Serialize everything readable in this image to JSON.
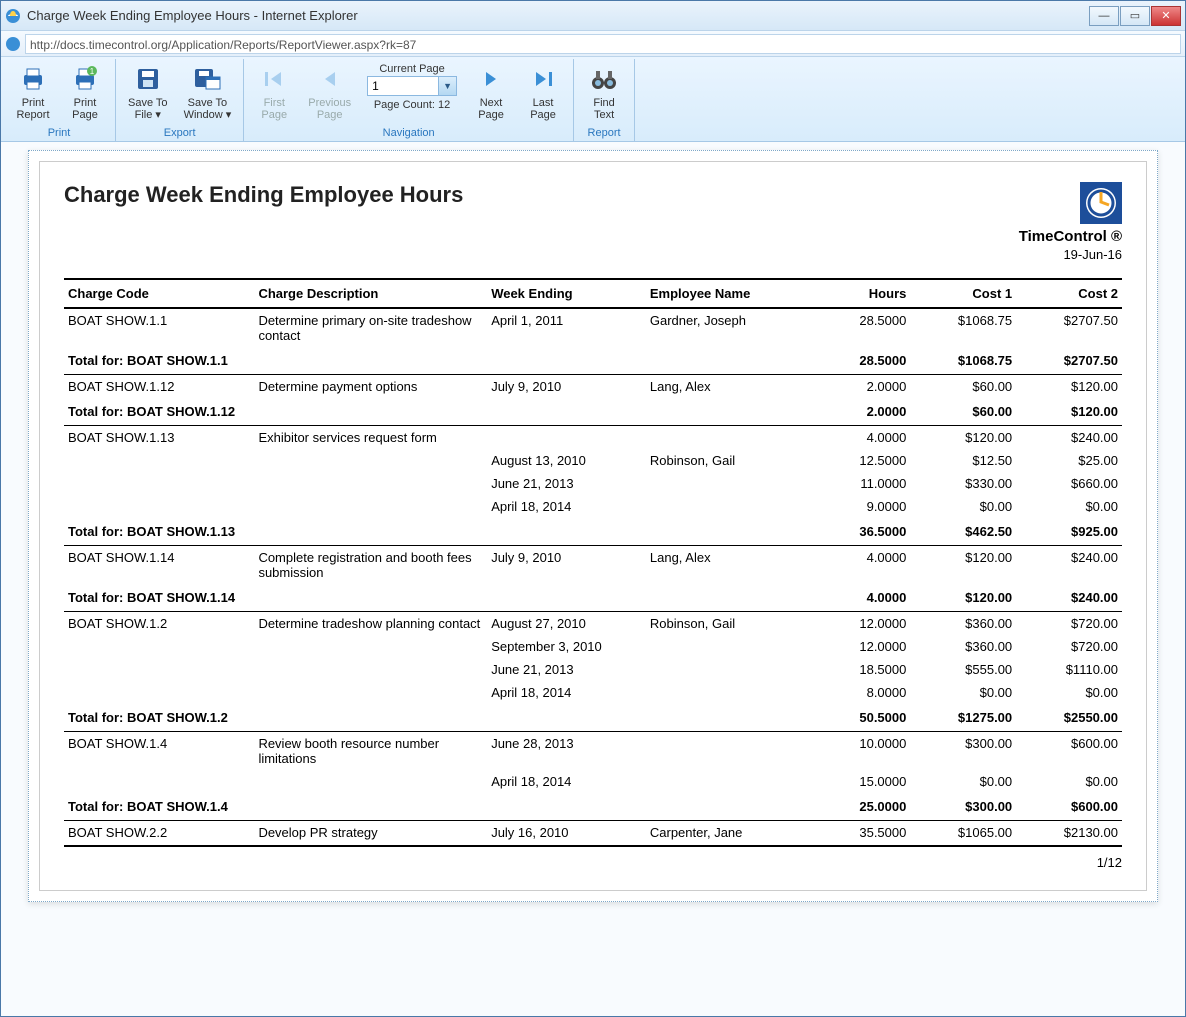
{
  "window": {
    "title": "Charge Week Ending Employee Hours - Internet Explorer",
    "url": "http://docs.timecontrol.org/Application/Reports/ReportViewer.aspx?rk=87"
  },
  "toolbar": {
    "groups": {
      "print": {
        "label": "Print",
        "print_report": "Print\nReport",
        "print_page": "Print\nPage"
      },
      "export": {
        "label": "Export",
        "save_to_file": "Save To\nFile ▾",
        "save_to_window": "Save To\nWindow ▾"
      },
      "navigation": {
        "label": "Navigation",
        "first_page": "First\nPage",
        "previous_page": "Previous\nPage",
        "next_page": "Next\nPage",
        "last_page": "Last\nPage",
        "current_page_label": "Current Page",
        "current_page_value": "1",
        "page_count_label": "Page Count: 12"
      },
      "report": {
        "label": "Report",
        "find_text": "Find\nText"
      }
    }
  },
  "report": {
    "title": "Charge Week Ending Employee Hours",
    "brand": "TimeControl ®",
    "date": "19-Jun-16",
    "page_footer": "1/12",
    "columns": {
      "charge_code": "Charge Code",
      "charge_description": "Charge Description",
      "week_ending": "Week Ending",
      "employee_name": "Employee Name",
      "hours": "Hours",
      "cost1": "Cost 1",
      "cost2": "Cost 2"
    },
    "total_prefix": "Total for: ",
    "groups": [
      {
        "code": "BOAT SHOW.1.1",
        "description": "Determine primary on-site tradeshow contact",
        "rows": [
          {
            "week": "April 1, 2011",
            "employee": "Gardner, Joseph",
            "hours": "28.5000",
            "cost1": "$1068.75",
            "cost2": "$2707.50"
          }
        ],
        "total": {
          "hours": "28.5000",
          "cost1": "$1068.75",
          "cost2": "$2707.50"
        }
      },
      {
        "code": "BOAT SHOW.1.12",
        "description": "Determine payment options",
        "rows": [
          {
            "week": "July 9, 2010",
            "employee": "Lang, Alex",
            "hours": "2.0000",
            "cost1": "$60.00",
            "cost2": "$120.00"
          }
        ],
        "total": {
          "hours": "2.0000",
          "cost1": "$60.00",
          "cost2": "$120.00"
        }
      },
      {
        "code": "BOAT SHOW.1.13",
        "description": "Exhibitor services request form",
        "rows": [
          {
            "week": "",
            "employee": "",
            "hours": "4.0000",
            "cost1": "$120.00",
            "cost2": "$240.00"
          },
          {
            "week": "August 13, 2010",
            "employee": "Robinson, Gail",
            "hours": "12.5000",
            "cost1": "$12.50",
            "cost2": "$25.00"
          },
          {
            "week": "June 21, 2013",
            "employee": "",
            "hours": "11.0000",
            "cost1": "$330.00",
            "cost2": "$660.00"
          },
          {
            "week": "April 18, 2014",
            "employee": "",
            "hours": "9.0000",
            "cost1": "$0.00",
            "cost2": "$0.00"
          }
        ],
        "total": {
          "hours": "36.5000",
          "cost1": "$462.50",
          "cost2": "$925.00"
        }
      },
      {
        "code": "BOAT SHOW.1.14",
        "description": "Complete registration and booth fees submission",
        "rows": [
          {
            "week": "July 9, 2010",
            "employee": "Lang, Alex",
            "hours": "4.0000",
            "cost1": "$120.00",
            "cost2": "$240.00"
          }
        ],
        "total": {
          "hours": "4.0000",
          "cost1": "$120.00",
          "cost2": "$240.00"
        }
      },
      {
        "code": "BOAT SHOW.1.2",
        "description": "Determine tradeshow planning contact",
        "rows": [
          {
            "week": "August 27, 2010",
            "employee": "Robinson, Gail",
            "hours": "12.0000",
            "cost1": "$360.00",
            "cost2": "$720.00"
          },
          {
            "week": "September 3, 2010",
            "employee": "",
            "hours": "12.0000",
            "cost1": "$360.00",
            "cost2": "$720.00"
          },
          {
            "week": "June 21, 2013",
            "employee": "",
            "hours": "18.5000",
            "cost1": "$555.00",
            "cost2": "$1110.00"
          },
          {
            "week": "April 18, 2014",
            "employee": "",
            "hours": "8.0000",
            "cost1": "$0.00",
            "cost2": "$0.00"
          }
        ],
        "total": {
          "hours": "50.5000",
          "cost1": "$1275.00",
          "cost2": "$2550.00"
        }
      },
      {
        "code": "BOAT SHOW.1.4",
        "description": "Review booth resource number limitations",
        "rows": [
          {
            "week": "June 28, 2013",
            "employee": "",
            "hours": "10.0000",
            "cost1": "$300.00",
            "cost2": "$600.00"
          },
          {
            "week": "April 18, 2014",
            "employee": "",
            "hours": "15.0000",
            "cost1": "$0.00",
            "cost2": "$0.00"
          }
        ],
        "total": {
          "hours": "25.0000",
          "cost1": "$300.00",
          "cost2": "$600.00"
        }
      },
      {
        "code": "BOAT SHOW.2.2",
        "description": "Develop PR strategy",
        "rows": [
          {
            "week": "July 16, 2010",
            "employee": "Carpenter, Jane",
            "hours": "35.5000",
            "cost1": "$1065.00",
            "cost2": "$2130.00"
          }
        ],
        "total": null
      }
    ]
  }
}
